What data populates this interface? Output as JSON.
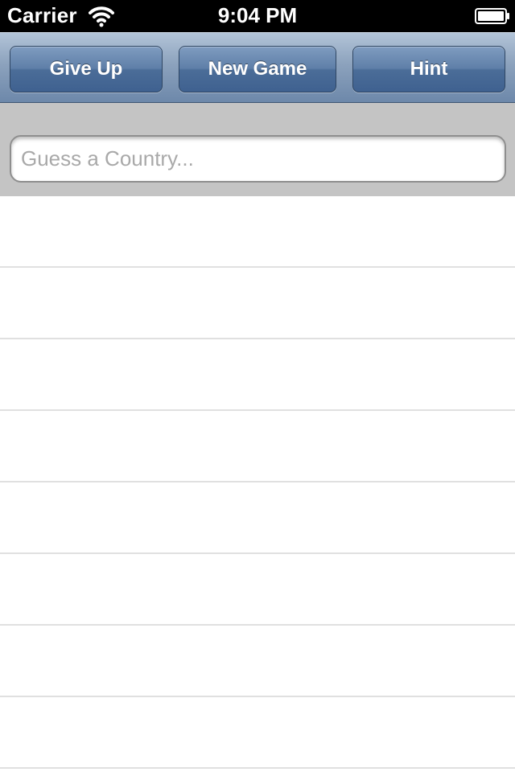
{
  "status_bar": {
    "carrier": "Carrier",
    "time": "9:04 PM",
    "icons": [
      "wifi-icon",
      "battery-icon"
    ]
  },
  "toolbar": {
    "give_up_label": "Give Up",
    "new_game_label": "New Game",
    "hint_label": "Hint"
  },
  "search": {
    "placeholder": "Guess a Country...",
    "value": ""
  },
  "list": {
    "rows": [
      "",
      "",
      "",
      "",
      "",
      "",
      "",
      ""
    ]
  },
  "colors": {
    "toolbar_button": "#4b6d98",
    "search_background": "#c4c4c4",
    "row_separator": "#e0e0e0"
  }
}
